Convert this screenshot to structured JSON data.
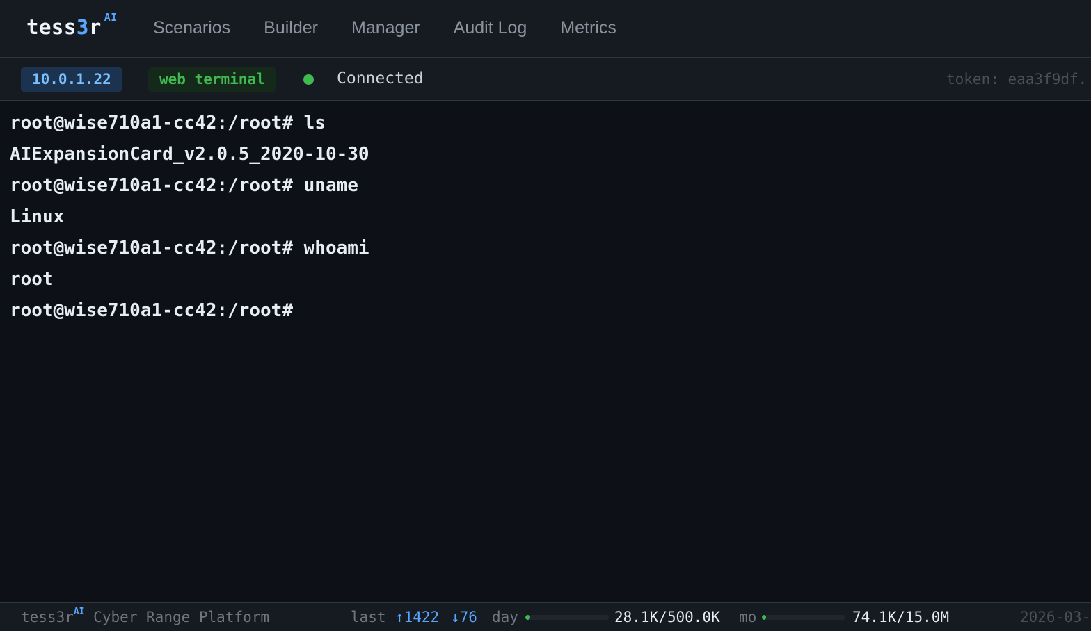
{
  "nav": {
    "brand_prefix": "tess",
    "brand_accent": "3",
    "brand_suffix": "r",
    "brand_sup": "AI",
    "links": [
      "Scenarios",
      "Builder",
      "Manager",
      "Audit Log",
      "Metrics"
    ]
  },
  "session": {
    "ip": "10.0.1.22",
    "type": "web terminal",
    "status": "Connected",
    "status_color": "#3fb950",
    "token": "token: eaa3f9df."
  },
  "terminal": {
    "lines": [
      "root@wise710a1-cc42:/root# ls",
      "AIExpansionCard_v2.0.5_2020-10-30",
      "root@wise710a1-cc42:/root# uname",
      "Linux",
      "root@wise710a1-cc42:/root# whoami",
      "root",
      "root@wise710a1-cc42:/root#"
    ]
  },
  "footer": {
    "brand": "tess3r",
    "brand_sup": "AI",
    "platform": "Cyber Range Platform",
    "last_label": "last",
    "up": "↑1422",
    "down": "↓76",
    "day_label": "day",
    "day_value": "28.1K/500.0K",
    "day_fraction": 0.056,
    "mo_label": "mo",
    "mo_value": "74.1K/15.0M",
    "mo_fraction": 0.005,
    "date": "2026-03-"
  }
}
